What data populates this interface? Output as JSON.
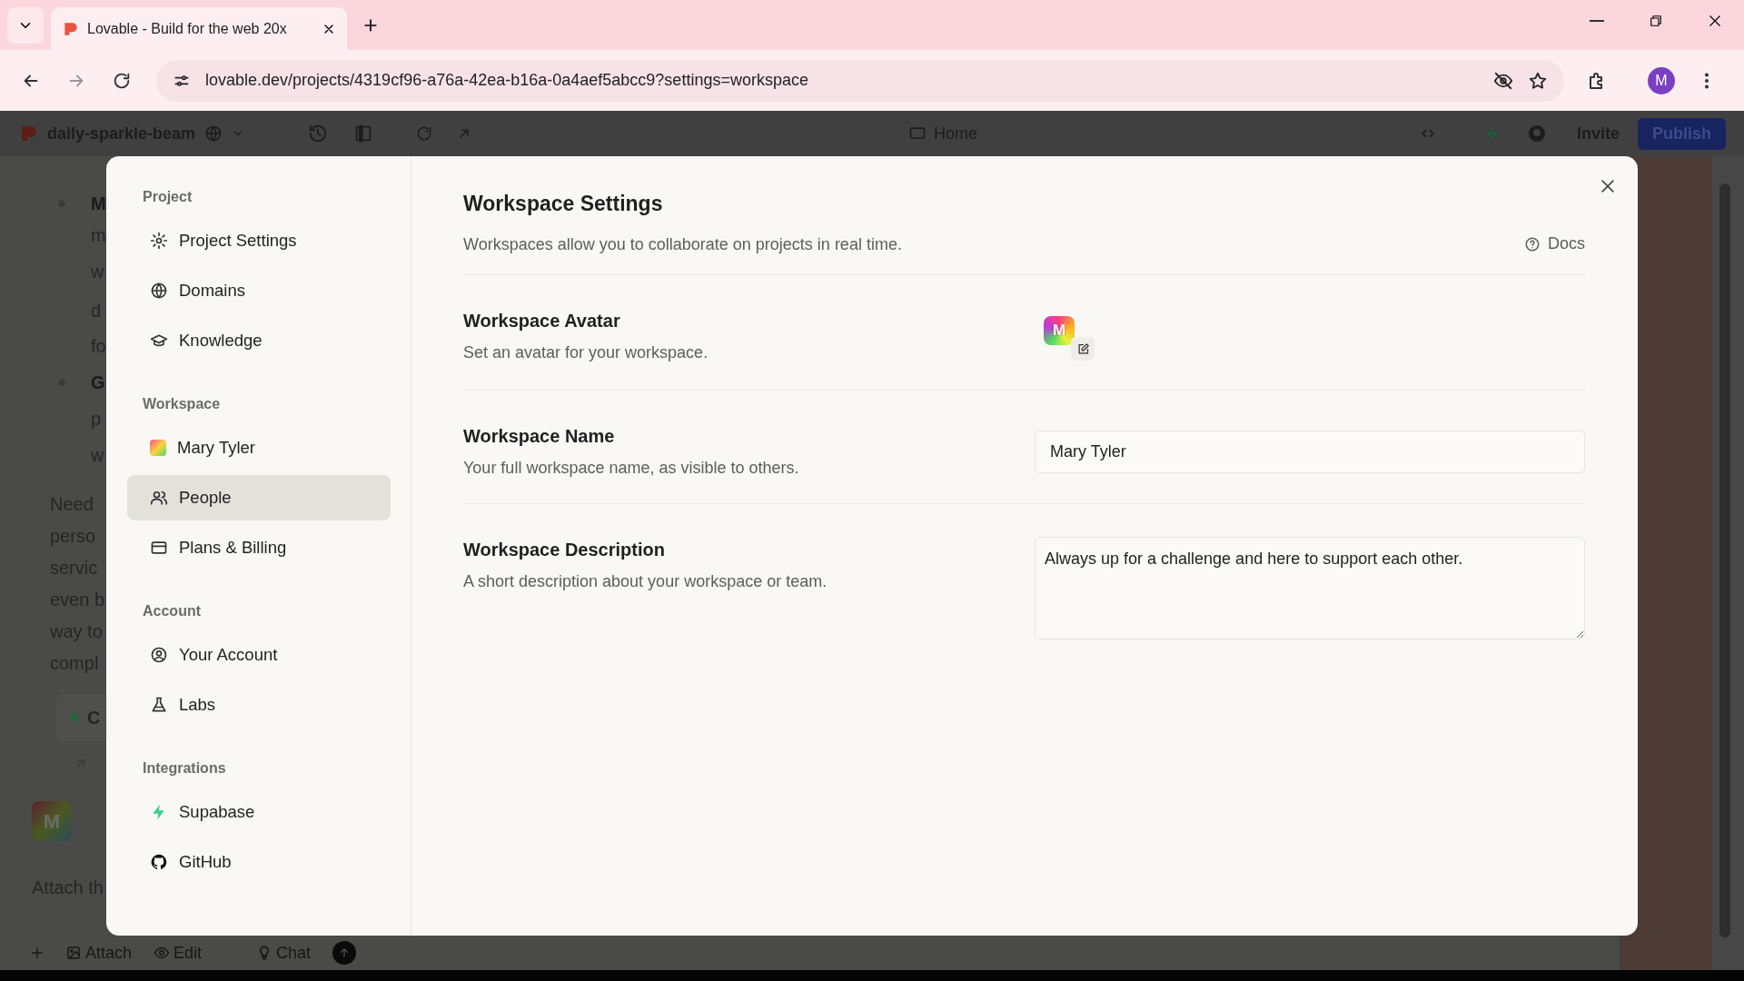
{
  "browser": {
    "tab_title": "Lovable - Build for the web 20x",
    "url": "lovable.dev/projects/4319cf96-a76a-42ea-b16a-0a4aef5abcc9?settings=workspace",
    "profile_initial": "M"
  },
  "app_bar": {
    "project_name": "daily-sparkle-beam",
    "page": "Home",
    "invite": "Invite",
    "publish": "Publish"
  },
  "chat": {
    "lines": [
      {
        "text": "M",
        "bold": true,
        "bullet": true
      },
      {
        "text": "m",
        "bold": false,
        "bullet": false
      },
      {
        "text": "w",
        "bold": false,
        "bullet": false
      },
      {
        "text": "d",
        "bold": false,
        "bullet": false
      },
      {
        "text": "fo",
        "bold": false,
        "bullet": false
      },
      {
        "text": "G",
        "bold": true,
        "bullet": true
      },
      {
        "text": "p",
        "bold": false,
        "bullet": false
      },
      {
        "text": "w",
        "bold": false,
        "bullet": false
      }
    ],
    "paragraph": [
      "Need",
      "perso",
      "servic",
      "even b",
      "way to",
      "compl"
    ],
    "card_label": "C",
    "avatar_initial": "M",
    "attach_hint": "Attach th",
    "toolbar": [
      "Attach",
      "Edit",
      "Chat"
    ]
  },
  "modal": {
    "sidebar": [
      {
        "heading": "Project",
        "items": [
          {
            "label": "Project Settings",
            "selected": false
          },
          {
            "label": "Domains",
            "selected": false
          },
          {
            "label": "Knowledge",
            "selected": false
          }
        ]
      },
      {
        "heading": "Workspace",
        "items": [
          {
            "label": "Mary Tyler",
            "selected": false
          },
          {
            "label": "People",
            "selected": true
          },
          {
            "label": "Plans & Billing",
            "selected": false
          }
        ]
      },
      {
        "heading": "Account",
        "items": [
          {
            "label": "Your Account",
            "selected": false
          },
          {
            "label": "Labs",
            "selected": false
          }
        ]
      },
      {
        "heading": "Integrations",
        "items": [
          {
            "label": "Supabase",
            "selected": false
          },
          {
            "label": "GitHub",
            "selected": false
          }
        ]
      }
    ],
    "title": "Workspace Settings",
    "subtitle": "Workspaces allow you to collaborate on projects in real time.",
    "docs": "Docs",
    "fields": [
      {
        "kind": "avatar",
        "title": "Workspace Avatar",
        "description": "Set an avatar for your workspace.",
        "initial": "M"
      },
      {
        "kind": "text",
        "title": "Workspace Name",
        "description": "Your full workspace name, as visible to others.",
        "value": "Mary Tyler"
      },
      {
        "kind": "textarea",
        "title": "Workspace Description",
        "description": "A short description about your workspace or team.",
        "value": "Always up for a challenge and here to support each other."
      }
    ]
  }
}
